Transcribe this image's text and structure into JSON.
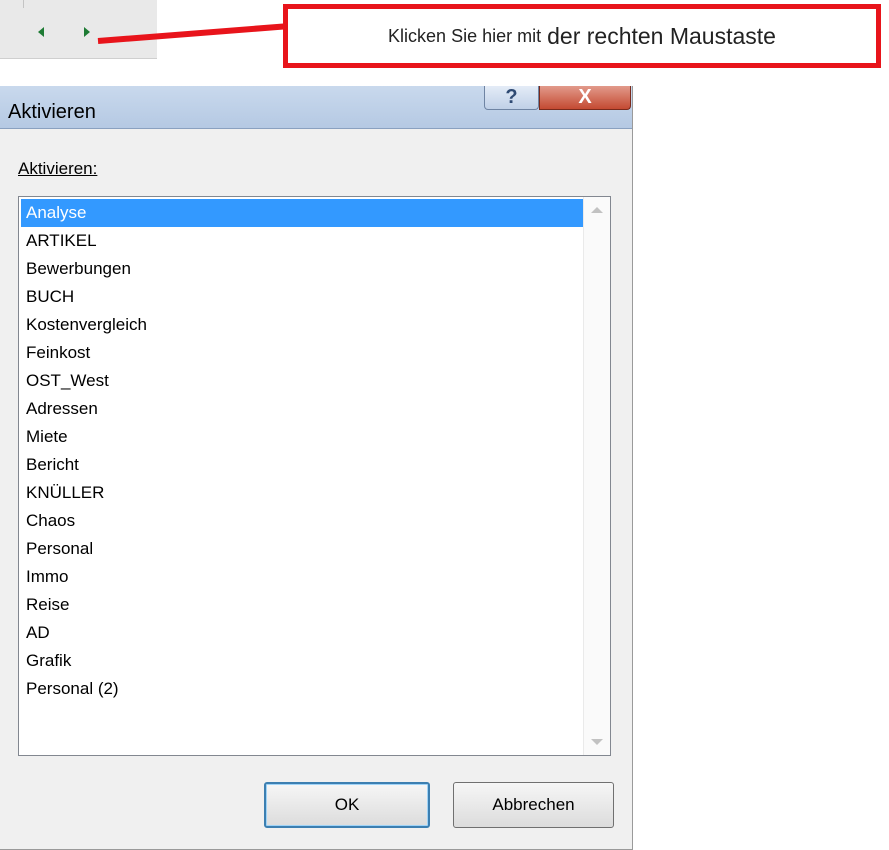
{
  "callout": {
    "text_small": "Klicken Sie hier mit",
    "text_large": "der rechten Maustaste",
    "border_color": "#e8141b"
  },
  "sheet_nav": {
    "prev_icon": "triangle-left-icon",
    "next_icon": "triangle-right-icon",
    "icon_color": "#1e7b34"
  },
  "dialog": {
    "title": "Aktivieren",
    "help_label": "?",
    "close_label": "X",
    "list_label": "Aktivieren:",
    "items": [
      "Analyse",
      "ARTIKEL",
      "Bewerbungen",
      "BUCH",
      "Kostenvergleich",
      "Feinkost",
      "OST_West",
      "Adressen",
      "Miete",
      "Bericht",
      "KNÜLLER",
      "Chaos",
      "Personal",
      "Immo",
      "Reise",
      "AD",
      "Grafik",
      "Personal (2)"
    ],
    "selected_item": "Analyse",
    "ok_label": "OK",
    "cancel_label": "Abbrechen",
    "selection_color": "#3399ff"
  }
}
